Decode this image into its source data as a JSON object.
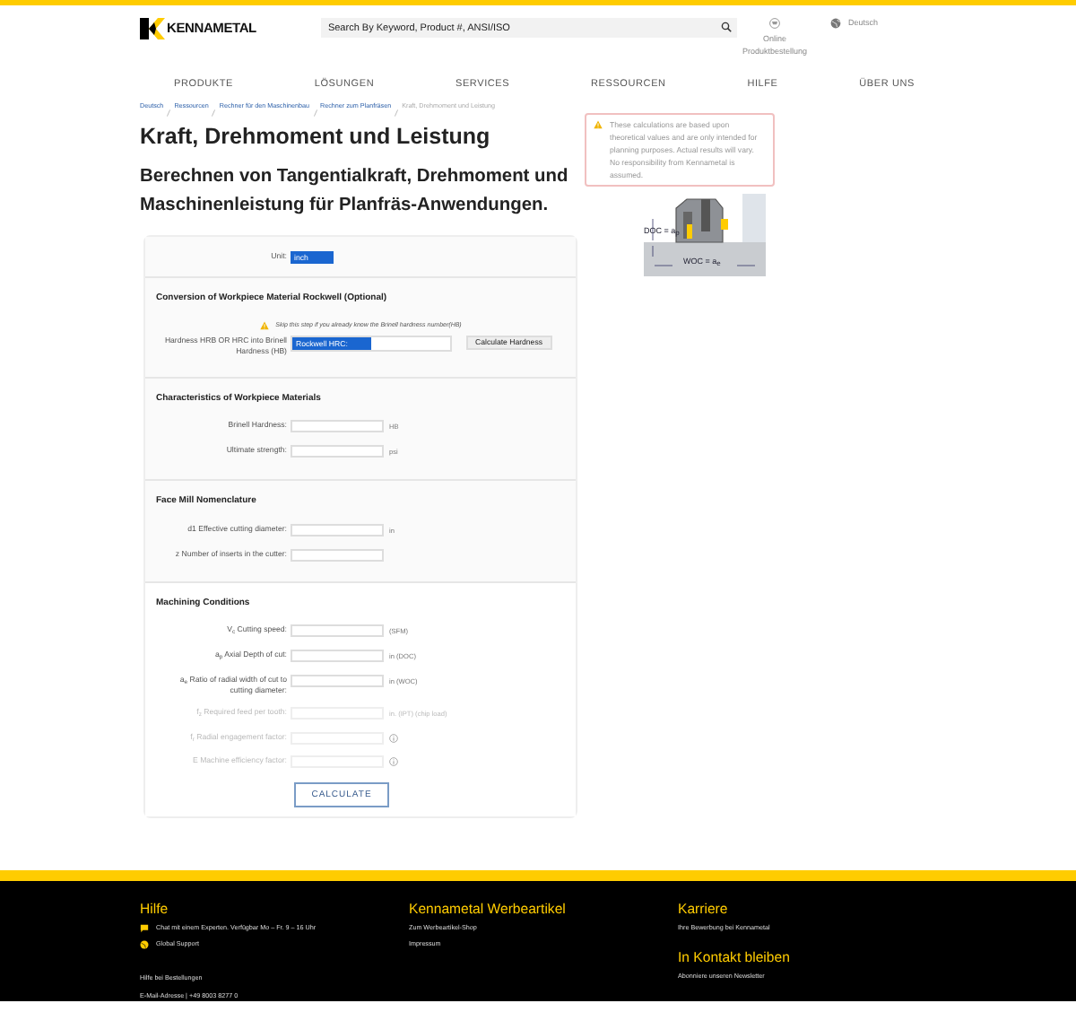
{
  "header": {
    "logo": "KENNAMETAL",
    "search": {
      "placeholder": "Search By Keyword, Product #, ANSI/ISO"
    },
    "order_link": "Online Produktbestellung",
    "language": "Deutsch"
  },
  "nav": [
    "PRODUKTE",
    "LÖSUNGEN",
    "SERVICES",
    "RESSOURCEN",
    "HILFE",
    "ÜBER UNS"
  ],
  "breadcrumb": [
    {
      "label": "Deutsch",
      "current": false
    },
    {
      "label": "Ressourcen",
      "current": false
    },
    {
      "label": "Rechner für den Maschinenbau",
      "current": false
    },
    {
      "label": "Rechner zum Planfräsen",
      "current": false
    },
    {
      "label": "Kraft, Drehmoment und Leistung",
      "current": true
    }
  ],
  "title": "Kraft, Drehmoment und Leistung",
  "subtitle": "Berechnen von Tangentialkraft, Drehmoment und Maschinenleistung für Planfräs-Anwendungen.",
  "notice": "These calculations are based upon theoretical values and are only intended for planning purposes. Actual results will vary. No responsibility from Kennametal is assumed.",
  "diagram": {
    "doc_label": "DOC = a$_{p}$",
    "woc_label": "WOC = a$_{e}$"
  },
  "form": {
    "sections": [
      {
        "rows": [
          {
            "kind": "select",
            "label": "Unit:",
            "value": "inch"
          }
        ]
      },
      {
        "title": "Conversion of Workpiece Material Rockwell (Optional)",
        "warning": "Skip this step if you already know the Brinell hardness number(HB)",
        "rows": [
          {
            "kind": "select-input",
            "label": "Hardness HRB OR HRC into Brinell Hardness (HB)",
            "value": "Rockwell HRC:",
            "button": "Calculate Hardness"
          }
        ]
      },
      {
        "title": "Characteristics of Workpiece Materials",
        "rows": [
          {
            "kind": "input",
            "label": "Brinell Hardness:",
            "unit": "HB",
            "disabled": false
          },
          {
            "kind": "input",
            "label": "Ultimate strength:",
            "unit": "psi",
            "disabled": false
          }
        ]
      },
      {
        "title": "Face Mill Nomenclature",
        "rows": [
          {
            "kind": "input",
            "label": "d1 Effective cutting diameter:",
            "unit": "in",
            "disabled": false
          },
          {
            "kind": "input",
            "label": "z Number of inserts in the cutter:",
            "disabled": false
          }
        ]
      },
      {
        "title": "Machining Conditions",
        "rows": [
          {
            "kind": "input",
            "label": "V$_{c}$ Cutting speed:",
            "unit": "(SFM)",
            "disabled": false
          },
          {
            "kind": "input",
            "label": "a$_{p}$ Axial Depth of cut:",
            "unit": "in (DOC)",
            "disabled": false
          },
          {
            "kind": "input",
            "label": "a$_{e}$ Ratio of radial width of cut to cutting diameter:",
            "unit": "in (WOC)",
            "disabled": false
          },
          {
            "kind": "input",
            "label": "f$_{z}$ Required feed per tooth:",
            "unit": "in. (IPT) (chip load)",
            "disabled": true
          },
          {
            "kind": "input",
            "label": "f$_{r}$ Radial engagement factor:",
            "info": true,
            "disabled": true
          },
          {
            "kind": "input",
            "label": "E Machine efficiency factor:",
            "info": true,
            "disabled": true
          }
        ]
      }
    ],
    "submit": "CALCULATE"
  },
  "footer": {
    "columns": [
      {
        "sections": [
          {
            "heading": "Hilfe",
            "links": [
              {
                "kind": "chat",
                "label": "Chat mit einem Experten. Verfügbar Mo – Fr. 9 – 16 Uhr"
              },
              {
                "kind": "globe",
                "label": "Global Support"
              }
            ]
          },
          {
            "links": [
              {
                "label": "Hilfe bei Bestellungen"
              },
              {
                "label": "E-Mail-Adresse | +49 8003 8277 0"
              }
            ]
          }
        ]
      },
      {
        "sections": [
          {
            "heading": "Kennametal Werbeartikel",
            "links": [
              {
                "label": "Zum Werbeartikel-Shop"
              },
              {
                "label": "Impressum"
              }
            ]
          }
        ]
      },
      {
        "sections": [
          {
            "heading": "Karriere",
            "links": [
              {
                "label": "Ihre Bewerbung bei Kennametal"
              }
            ]
          },
          {
            "heading": "In Kontakt bleiben",
            "links": [
              {
                "label": "Abonniere unseren Newsletter"
              }
            ]
          }
        ]
      }
    ]
  }
}
